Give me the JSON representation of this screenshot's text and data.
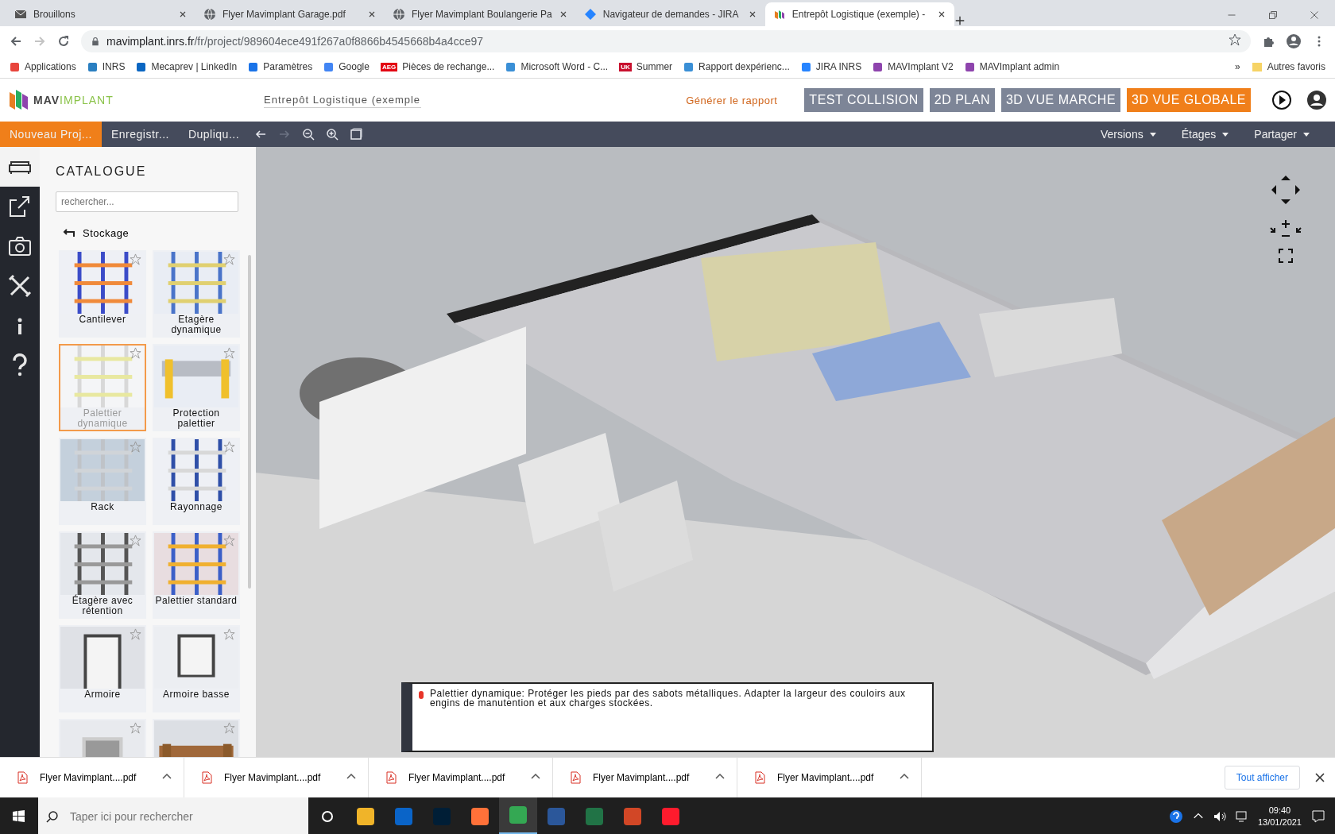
{
  "browser": {
    "tabs": [
      {
        "kind": "mail",
        "title": "Brouillons",
        "selected": false
      },
      {
        "kind": "globe",
        "title": "Flyer Mavimplant Garage.pdf",
        "selected": false
      },
      {
        "kind": "globe",
        "title": "Flyer Mavimplant Boulangerie Pa",
        "selected": false
      },
      {
        "kind": "diamond",
        "title": "Navigateur de demandes - JIRA",
        "selected": false
      },
      {
        "kind": "logo",
        "title": "Entrepôt Logistique (exemple) -",
        "selected": true
      }
    ],
    "nav": [
      {
        "kind": "back",
        "disabled": false
      },
      {
        "kind": "forward",
        "disabled": true
      },
      {
        "kind": "reload",
        "disabled": false
      }
    ],
    "url_host": "mavimplant.inrs.fr",
    "url_path": "/fr/project/989604ece491f267a0f8866b4545668b4a4cce97",
    "bookmarks": [
      {
        "label": "Applications",
        "color": "#e8453c"
      },
      {
        "label": "INRS",
        "color": "#2a7fc1"
      },
      {
        "label": "Mecaprev | LinkedIn",
        "color": "#0a66c2"
      },
      {
        "label": "Paramètres",
        "color": "#1a73e8"
      },
      {
        "label": "Google",
        "color": "#4285f4"
      },
      {
        "label": "Pièces de rechange...",
        "color": "#e30613",
        "badge": "AEG"
      },
      {
        "label": "Microsoft Word - C...",
        "color": "#3a8fd6"
      },
      {
        "label": "Summer",
        "color": "#c8102e",
        "badge": "UK"
      },
      {
        "label": "Rapport dexpérienc...",
        "color": "#3a8fd6"
      },
      {
        "label": "JIRA INRS",
        "color": "#2684ff"
      },
      {
        "label": "MAVImplant V2",
        "color": "#8e44ad"
      },
      {
        "label": "MAVImplant admin",
        "color": "#8e44ad"
      }
    ],
    "more": "»",
    "other_bookmarks": "Autres favoris"
  },
  "app": {
    "logo_a": "MAV",
    "logo_b": "IMPLANT",
    "project_name": "Entrepôt Logistique (exemple",
    "report_link": "Générer le rapport",
    "views": [
      {
        "label": "TEST COLLISION",
        "selected": false
      },
      {
        "label": "2D PLAN",
        "selected": false
      },
      {
        "label": "3D VUE MARCHE",
        "selected": false
      },
      {
        "label": "3D VUE GLOBALE",
        "selected": true
      }
    ],
    "menu": [
      {
        "label": "Nouveau Proj...",
        "selected": true
      },
      {
        "label": "Enregistr...",
        "selected": false
      },
      {
        "label": "Dupliqu...",
        "selected": false
      }
    ],
    "tools": [
      {
        "kind": "undo",
        "disabled": false
      },
      {
        "kind": "redo",
        "disabled": true
      },
      {
        "kind": "zoom-out",
        "disabled": false
      },
      {
        "kind": "zoom-in",
        "disabled": false
      },
      {
        "kind": "frame",
        "disabled": false
      }
    ],
    "dropdowns": [
      "Versions",
      "Étages",
      "Partager"
    ],
    "rail": [
      {
        "kind": "sofa",
        "selected": true
      },
      {
        "kind": "export",
        "selected": false
      },
      {
        "kind": "camera",
        "selected": false
      },
      {
        "kind": "tools",
        "selected": false
      },
      {
        "kind": "info",
        "selected": false
      },
      {
        "kind": "help",
        "selected": false
      }
    ],
    "catalogue": {
      "title": "CATALOGUE",
      "search_placeholder": "rechercher...",
      "back": "Stockage",
      "items": [
        {
          "label": "Cantilever",
          "selected": false
        },
        {
          "label": "Etagère dynamique",
          "selected": false
        },
        {
          "label": "Palettier dynamique",
          "selected": true
        },
        {
          "label": "Protection palettier",
          "selected": false
        },
        {
          "label": "Rack",
          "selected": false
        },
        {
          "label": "Rayonnage",
          "selected": false
        },
        {
          "label": "Étagère avec rétention",
          "selected": false
        },
        {
          "label": "Palettier standard",
          "selected": false
        },
        {
          "label": "Armoire",
          "selected": false
        },
        {
          "label": "Armoire basse",
          "selected": false
        },
        {
          "kind": "picture",
          "selected": false
        },
        {
          "kind": "picture",
          "selected": false
        }
      ]
    },
    "tooltip": "Palettier dynamique: Protéger les pieds par des sabots métalliques. Adapter la largeur des couloirs aux engins de manutention et aux charges stockées."
  },
  "downloads": {
    "items": [
      "Flyer Mavimplant....pdf",
      "Flyer Mavimplant....pdf",
      "Flyer Mavimplant....pdf",
      "Flyer Mavimplant....pdf",
      "Flyer Mavimplant....pdf"
    ],
    "show_all": "Tout afficher"
  },
  "taskbar": {
    "search_placeholder": "Taper ici pour rechercher",
    "apps": [
      {
        "color": "#f0b429",
        "selected": false
      },
      {
        "color": "#0a64c8",
        "selected": false
      },
      {
        "color": "#001e36",
        "selected": false
      },
      {
        "color": "#ff7139",
        "selected": false
      },
      {
        "color": "#34a853",
        "selected": true
      },
      {
        "color": "#2b579a",
        "selected": false
      },
      {
        "color": "#217346",
        "selected": false
      },
      {
        "color": "#d24726",
        "selected": false
      },
      {
        "color": "#ff1b2d",
        "selected": false
      }
    ],
    "time": "09:40",
    "date": "13/01/2021"
  }
}
